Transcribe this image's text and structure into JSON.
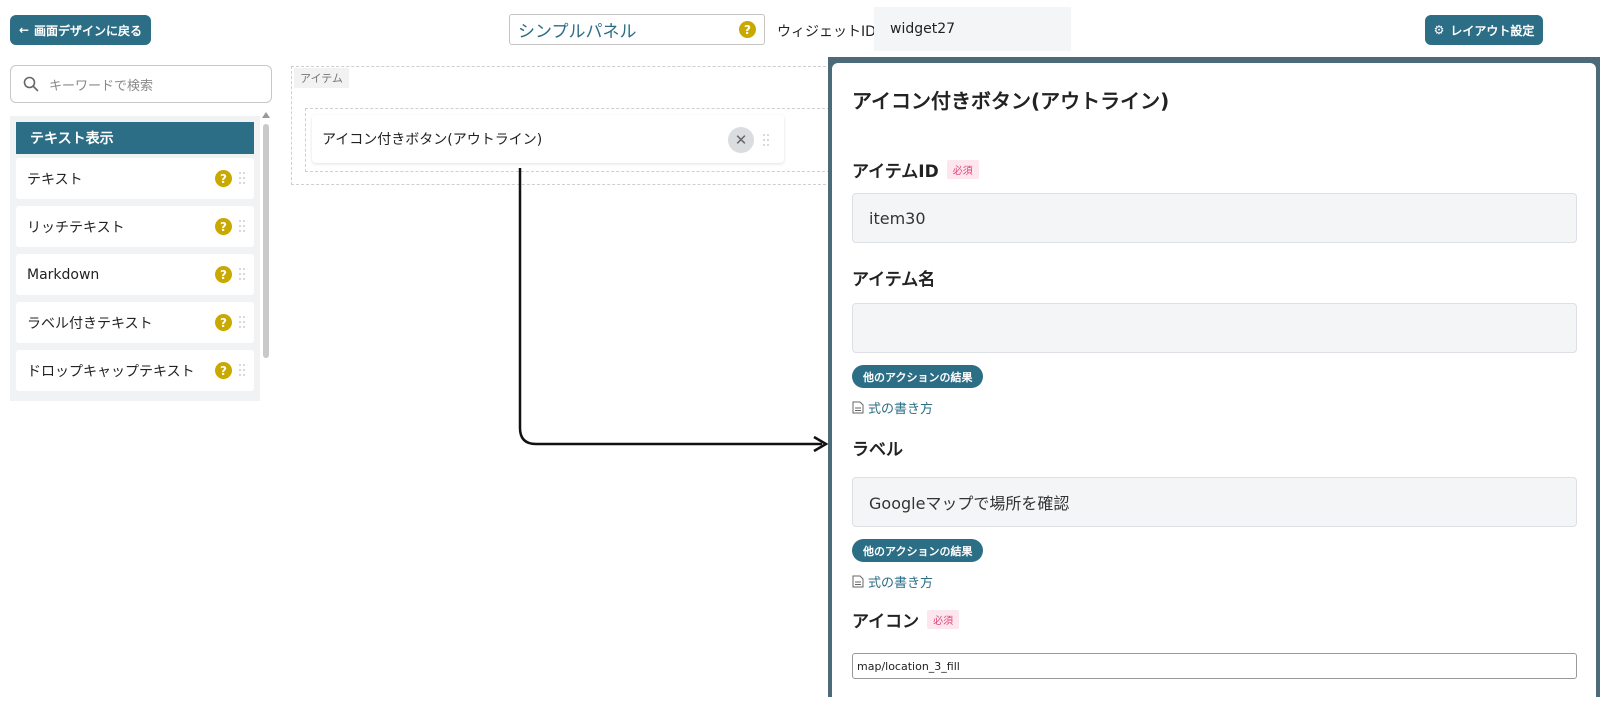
{
  "header": {
    "back_label": "画面デザインに戻る",
    "panel_title": "シンプルパネル",
    "help_glyph": "?",
    "widget_id_label": "ウィジェットID",
    "widget_id_value": "widget27",
    "layout_settings_label": "レイアウト設定"
  },
  "search": {
    "placeholder": "キーワードで検索"
  },
  "palette": {
    "category": "テキスト表示",
    "items": [
      {
        "label": "テキスト"
      },
      {
        "label": "リッチテキスト"
      },
      {
        "label": "Markdown"
      },
      {
        "label": "ラベル付きテキスト"
      },
      {
        "label": "ドロップキャップテキスト"
      }
    ]
  },
  "canvas": {
    "area_label": "アイテム",
    "item_label": "アイコン付きボタン(アウトライン)",
    "close_glyph": "✕"
  },
  "properties": {
    "title": "アイコン付きボタン(アウトライン)",
    "required_badge": "必須",
    "item_id_label": "アイテムID",
    "item_id_value": "item30",
    "item_name_label": "アイテム名",
    "item_name_value": "",
    "action_result_pill": "他のアクションの結果",
    "formula_link": "式の書き方",
    "label_label": "ラベル",
    "label_value": "Googleマップで場所を確認",
    "icon_label": "アイコン",
    "icon_value": "map/location_3_fill"
  },
  "colors": {
    "accent": "#2c6e85",
    "help": "#c9a800",
    "required": "#e0457b",
    "panel_border": "#4d6a78"
  }
}
